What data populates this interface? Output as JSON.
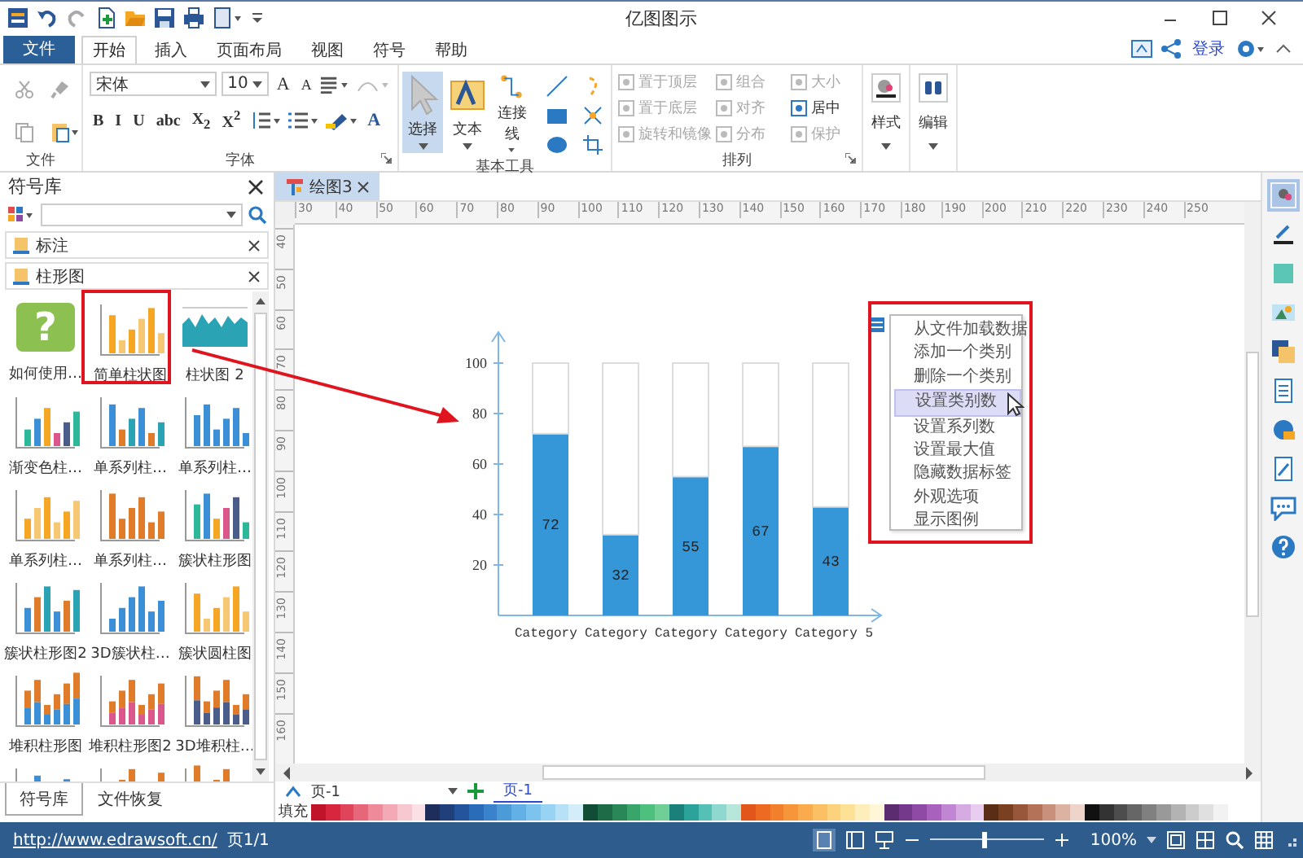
{
  "window": {
    "title": "亿图图示"
  },
  "ribbon": {
    "file_tab": "文件",
    "tabs": [
      {
        "label": "开始",
        "selected": true
      },
      {
        "label": "插入",
        "selected": false
      },
      {
        "label": "页面布局",
        "selected": false
      },
      {
        "label": "视图",
        "selected": false
      },
      {
        "label": "符号",
        "selected": false
      },
      {
        "label": "帮助",
        "selected": false
      }
    ],
    "login": "登录",
    "file_group": {
      "label": "文件"
    },
    "font_group": {
      "label": "字体",
      "font": "宋体",
      "size": "10",
      "grow": "A",
      "shrink": "A",
      "styles": [
        "B",
        "I",
        "U",
        "abc",
        "X$_{2}$",
        "X$^{2}$"
      ],
      "color_button": "A"
    },
    "tools_group": {
      "label": "基本工具",
      "tools": [
        {
          "label": "选择",
          "selected": true
        },
        {
          "label": "文本",
          "selected": false
        },
        {
          "label": "连接线",
          "selected": false
        }
      ]
    },
    "arrange_group": {
      "label": "排列",
      "items": [
        {
          "label": "置于顶层",
          "disabled": true
        },
        {
          "label": "置于底层",
          "disabled": true
        },
        {
          "label": "旋转和镜像",
          "disabled": true
        },
        {
          "label": "组合",
          "disabled": true
        },
        {
          "label": "对齐",
          "disabled": true
        },
        {
          "label": "分布",
          "disabled": true
        },
        {
          "label": "大小",
          "disabled": true
        },
        {
          "label": "居中",
          "disabled": false
        },
        {
          "label": "保护",
          "disabled": true
        }
      ]
    },
    "style": "样式",
    "edit": "编辑"
  },
  "library": {
    "title": "符号库",
    "sections": [
      {
        "label": "标注"
      },
      {
        "label": "柱形图"
      }
    ],
    "items": [
      {
        "label": "如何使用…",
        "kind": "help",
        "glyph": "?"
      },
      {
        "label": "简单柱状图",
        "kind": "chart"
      },
      {
        "label": "柱状图 2",
        "kind": "area"
      },
      {
        "label": "渐变色柱…",
        "kind": "chart"
      },
      {
        "label": "单系列柱…",
        "kind": "chart"
      },
      {
        "label": "单系列柱…",
        "kind": "chart"
      },
      {
        "label": "单系列柱…",
        "kind": "chart"
      },
      {
        "label": "单系列柱…",
        "kind": "chart"
      },
      {
        "label": "簇状柱形图",
        "kind": "chart"
      },
      {
        "label": "簇状柱形图2",
        "kind": "chart"
      },
      {
        "label": "3D簇状柱…",
        "kind": "chart"
      },
      {
        "label": "簇状圆柱图",
        "kind": "chart"
      },
      {
        "label": "堆积柱形图",
        "kind": "stacked"
      },
      {
        "label": "堆积柱形图2",
        "kind": "stacked"
      },
      {
        "label": "3D堆积柱…",
        "kind": "stacked"
      },
      {
        "kind": "chart"
      },
      {
        "kind": "stacked"
      },
      {
        "kind": "stacked"
      }
    ],
    "bottom_tabs": [
      {
        "label": "符号库",
        "selected": true
      },
      {
        "label": "文件恢复",
        "selected": false
      }
    ]
  },
  "document": {
    "tab": "绘图3",
    "ruler_h": [
      "30",
      "40",
      "50",
      "60",
      "70",
      "80",
      "90",
      "100",
      "110",
      "120",
      "130",
      "140",
      "150",
      "160",
      "170",
      "180",
      "190",
      "200",
      "210",
      "220",
      "230",
      "240",
      "250"
    ],
    "ruler_v": [
      "40",
      "50",
      "60",
      "70",
      "80",
      "90",
      "100",
      "110",
      "120",
      "130",
      "140",
      "150",
      "160"
    ],
    "chart": {
      "chart_data": {
        "type": "bar",
        "categories": [
          "Category",
          "Category",
          "Category",
          "Category",
          "Category 5"
        ],
        "series": [
          {
            "color": "#3597d8",
            "values": [
              72,
              32,
              55,
              67,
              43
            ]
          },
          {
            "color": "#ffffff",
            "values": [
              28,
              68,
              45,
              33,
              57
            ]
          }
        ],
        "stacked": true,
        "ylim": [
          0,
          100
        ],
        "yticks": [
          20,
          40,
          60,
          80,
          100
        ],
        "value_labels": [
          [
            "72",
            "32",
            "55",
            "67",
            "43"
          ],
          [
            null,
            null,
            null,
            null,
            null
          ]
        ]
      }
    },
    "menu": {
      "items": [
        {
          "label": "从文件加载数据",
          "selected": false
        },
        {
          "label": "添加一个类别",
          "selected": false
        },
        {
          "label": "删除一个类别",
          "selected": false
        },
        {
          "label": "设置类别数",
          "selected": true
        },
        {
          "label": "设置系列数",
          "selected": false
        },
        {
          "label": "设置最大值",
          "selected": false
        },
        {
          "label": "隐藏数据标签",
          "selected": false
        },
        {
          "label": "外观选项",
          "selected": false
        },
        {
          "label": "显示图例",
          "selected": false
        }
      ]
    }
  },
  "pages": {
    "current": "页-1",
    "tabs": [
      {
        "label": "页-1",
        "selected": true
      }
    ]
  },
  "fill": {
    "label": "填充",
    "swatches": [
      {
        "color": "#c0142b"
      },
      {
        "color": "#d7263d"
      },
      {
        "color": "#e0445a"
      },
      {
        "color": "#e8667a"
      },
      {
        "color": "#ef8a9a"
      },
      {
        "color": "#f4aab6"
      },
      {
        "color": "#f8c8d0"
      },
      {
        "color": "#fbe0e5"
      },
      {
        "color": "#1f2d5a"
      },
      {
        "color": "#213f7a"
      },
      {
        "color": "#24559c"
      },
      {
        "color": "#2a6cb8"
      },
      {
        "color": "#3b82cc"
      },
      {
        "color": "#4d9ad9"
      },
      {
        "color": "#63b0e6"
      },
      {
        "color": "#7cc4ef"
      },
      {
        "color": "#98d3f3"
      },
      {
        "color": "#b6e1f7"
      },
      {
        "color": "#d3eefa"
      },
      {
        "color": "#114d36"
      },
      {
        "color": "#1d6b47"
      },
      {
        "color": "#2a8757"
      },
      {
        "color": "#3aa56a"
      },
      {
        "color": "#4fbf7f"
      },
      {
        "color": "#6fcf97"
      },
      {
        "color": "#1b7f7a"
      },
      {
        "color": "#2ba39b"
      },
      {
        "color": "#55c1b6"
      },
      {
        "color": "#8fd8cf"
      },
      {
        "color": "#b9e6da"
      },
      {
        "color": "#e2561b"
      },
      {
        "color": "#ec6a22"
      },
      {
        "color": "#f27f2b"
      },
      {
        "color": "#f7953a"
      },
      {
        "color": "#f9ab4d"
      },
      {
        "color": "#fbc063"
      },
      {
        "color": "#fcd27c"
      },
      {
        "color": "#fde197"
      },
      {
        "color": "#feeebb"
      },
      {
        "color": "#fff6d8"
      },
      {
        "color": "#5b2c6f"
      },
      {
        "color": "#74398b"
      },
      {
        "color": "#8e4aa5"
      },
      {
        "color": "#a862bd"
      },
      {
        "color": "#c085d3"
      },
      {
        "color": "#d6abe3"
      },
      {
        "color": "#e8cdf0"
      },
      {
        "color": "#5a2e16"
      },
      {
        "color": "#7a4022"
      },
      {
        "color": "#98573a"
      },
      {
        "color": "#b47258"
      },
      {
        "color": "#c9917c"
      },
      {
        "color": "#dcb3a3"
      },
      {
        "color": "#eed4ca"
      },
      {
        "color": "#111111"
      },
      {
        "color": "#333333"
      },
      {
        "color": "#4d4d4d"
      },
      {
        "color": "#666666"
      },
      {
        "color": "#808080"
      },
      {
        "color": "#999999"
      },
      {
        "color": "#b3b3b3"
      },
      {
        "color": "#cccccc"
      },
      {
        "color": "#e0e0e0"
      },
      {
        "color": "#f2f2f2"
      }
    ]
  },
  "status": {
    "link": "http://www.edrawsoft.cn/",
    "page": "页1/1",
    "zoom": "100%",
    "zoom_slider": {
      "level": 0.45
    }
  }
}
